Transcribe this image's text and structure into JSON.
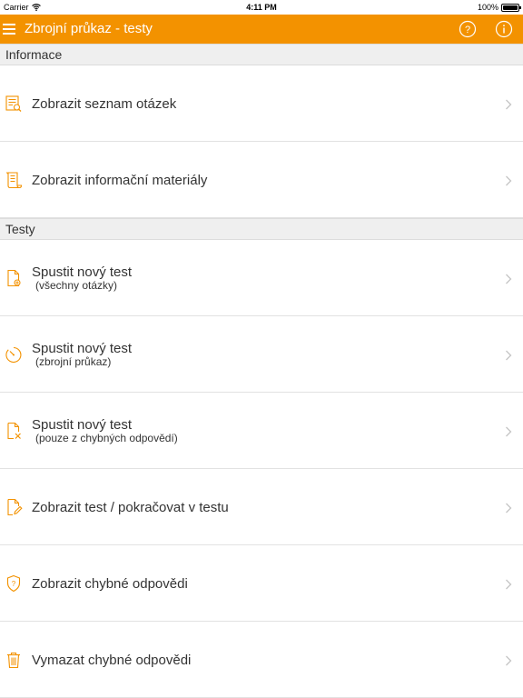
{
  "status_bar": {
    "carrier": "Carrier",
    "time": "4:11 PM",
    "battery": "100%"
  },
  "navbar": {
    "title": "Zbrojní průkaz - testy",
    "background": "#f39200"
  },
  "sections": {
    "info": {
      "header": "Informace",
      "items": [
        {
          "label": "Zobrazit seznam otázek",
          "icon": "question-list-icon"
        },
        {
          "label": "Zobrazit informační materiály",
          "icon": "document-scroll-icon"
        }
      ]
    },
    "tests": {
      "header": "Testy",
      "items": [
        {
          "label": "Spustit nový test",
          "sublabel": "(všechny otázky)",
          "icon": "document-add-icon"
        },
        {
          "label": "Spustit nový test",
          "sublabel": "(zbrojní průkaz)",
          "icon": "timer-icon"
        },
        {
          "label": "Spustit nový test",
          "sublabel": "(pouze z chybných odpovědí)",
          "icon": "document-x-icon"
        },
        {
          "label": "Zobrazit test / pokračovat v testu",
          "icon": "document-edit-icon"
        },
        {
          "label": "Zobrazit chybné odpovědi",
          "icon": "shield-question-icon"
        },
        {
          "label": "Vymazat chybné odpovědi",
          "icon": "trash-icon"
        }
      ]
    }
  },
  "accent_color": "#f39200"
}
